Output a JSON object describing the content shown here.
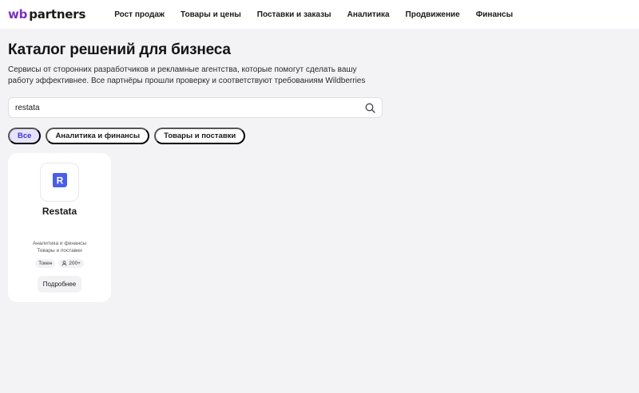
{
  "header": {
    "logo": {
      "wb": "wb",
      "partners": "partners"
    },
    "nav": [
      {
        "id": "growth",
        "label": "Рост продаж"
      },
      {
        "id": "goods",
        "label": "Товары и цены"
      },
      {
        "id": "supplies",
        "label": "Поставки и заказы"
      },
      {
        "id": "analytics",
        "label": "Аналитика"
      },
      {
        "id": "promotion",
        "label": "Продвижение"
      },
      {
        "id": "finance",
        "label": "Финансы"
      }
    ]
  },
  "main": {
    "title": "Каталог решений для бизнеса",
    "subtitle": "Сервисы от сторонних разработчиков и рекламные агентства, которые помогут сделать вашу работу эффективнее. Все партнёры прошли проверку и соответствуют требованиям Wildberries",
    "search": {
      "value": "restata",
      "placeholder": ""
    },
    "filters": [
      {
        "id": "all",
        "label": "Все",
        "active": true
      },
      {
        "id": "analytics-finance",
        "label": "Аналитика и финансы",
        "active": false
      },
      {
        "id": "goods-supplies",
        "label": "Товары и поставки",
        "active": false
      }
    ],
    "cards": [
      {
        "name": "Restata",
        "logo_letter": "R",
        "categories": [
          "Аналитика и финансы",
          "Товары и поставки"
        ],
        "tags": {
          "token": "Токен",
          "count": "200+"
        },
        "button": "Подробнее"
      }
    ]
  },
  "colors": {
    "brand_purple": "#7b2fbf",
    "active_chip_bg": "#e5e2fb",
    "active_chip_text": "#3f33c7",
    "restata_logo": "#4a5ee8",
    "page_bg": "#f3f3f6"
  },
  "icons": {
    "search": "search-icon",
    "restata_logo": "restata-logo-icon",
    "users": "users-icon"
  }
}
